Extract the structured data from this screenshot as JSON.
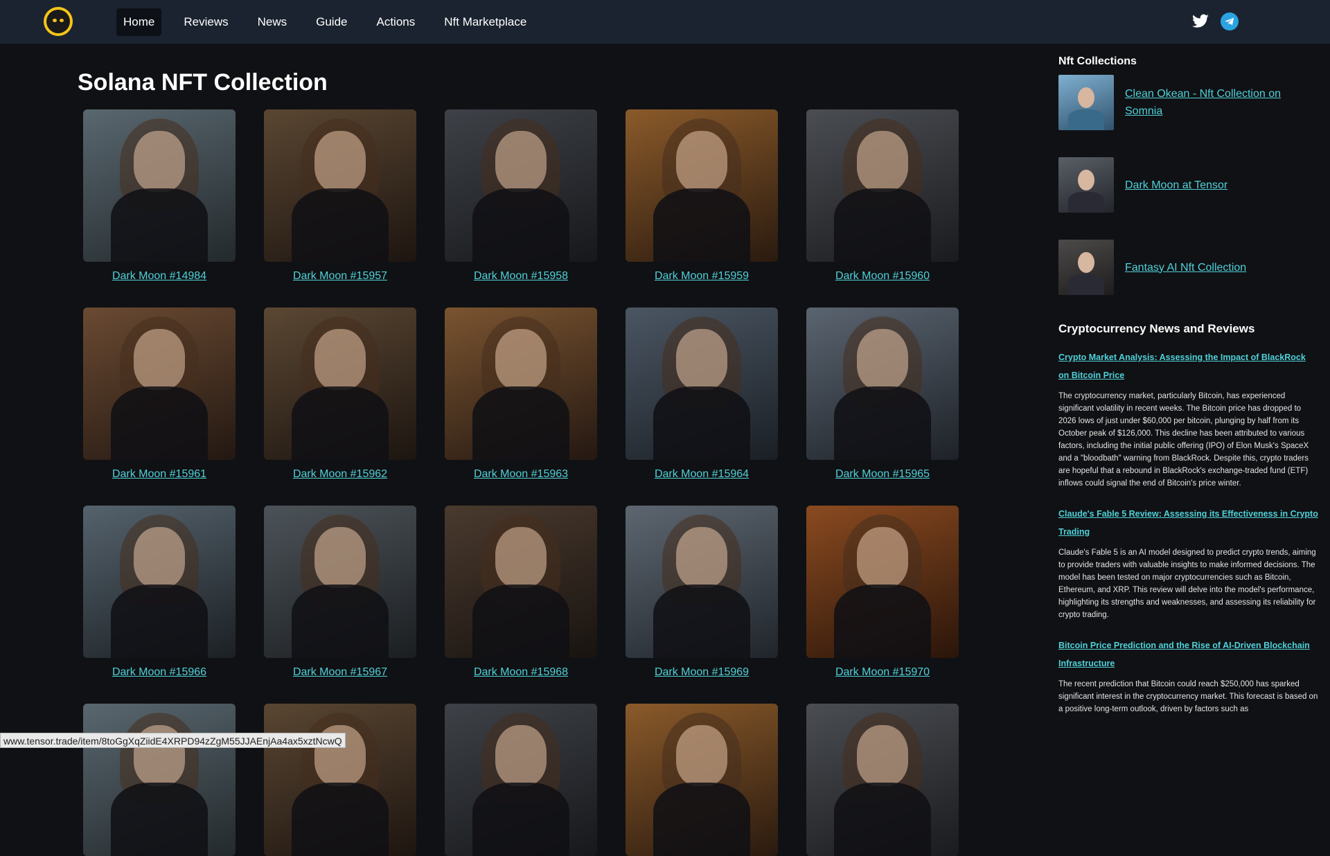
{
  "nav": {
    "items": [
      {
        "label": "Home",
        "active": true
      },
      {
        "label": "Reviews"
      },
      {
        "label": "News"
      },
      {
        "label": "Guide"
      },
      {
        "label": "Actions"
      },
      {
        "label": "Nft Marketplace"
      }
    ]
  },
  "social": [
    "twitter-icon",
    "telegram-icon"
  ],
  "page_title": "Solana NFT Collection",
  "nfts": [
    "Dark Moon #14984",
    "Dark Moon #15957",
    "Dark Moon #15958",
    "Dark Moon #15959",
    "Dark Moon #15960",
    "Dark Moon #15961",
    "Dark Moon #15962",
    "Dark Moon #15963",
    "Dark Moon #15964",
    "Dark Moon #15965",
    "Dark Moon #15966",
    "Dark Moon #15967",
    "Dark Moon #15968",
    "Dark Moon #15969",
    "Dark Moon #15970"
  ],
  "sidebar": {
    "collections_heading": "Nft Collections",
    "collections": [
      "Clean Okean - Nft Collection on Somnia",
      "Dark Moon at Tensor",
      "Fantasy AI Nft Collection"
    ],
    "news_heading": "Cryptocurrency News and Reviews",
    "articles": [
      {
        "title": "Crypto Market Analysis: Assessing the Impact of BlackRock on Bitcoin Price",
        "text": "The cryptocurrency market, particularly Bitcoin, has experienced significant volatility in recent weeks. The Bitcoin price has dropped to 2026 lows of just under $60,000 per bitcoin, plunging by half from its October peak of $126,000. This decline has been attributed to various factors, including the initial public offering (IPO) of Elon Musk's SpaceX and a \"bloodbath\" warning from BlackRock. Despite this, crypto traders are hopeful that a rebound in BlackRock's exchange-traded fund (ETF) inflows could signal the end of Bitcoin's price winter."
      },
      {
        "title": "Claude's Fable 5 Review: Assessing its Effectiveness in Crypto Trading",
        "text": "Claude's Fable 5 is an AI model designed to predict crypto trends, aiming to provide traders with valuable insights to make informed decisions. The model has been tested on major cryptocurrencies such as Bitcoin, Ethereum, and XRP. This review will delve into the model's performance, highlighting its strengths and weaknesses, and assessing its reliability for crypto trading."
      },
      {
        "title": "Bitcoin Price Prediction and the Rise of AI-Driven Blockchain Infrastructure",
        "text": "The recent prediction that Bitcoin could reach $250,000 has sparked significant interest in the cryptocurrency market. This forecast is based on a positive long-term outlook, driven by factors such as"
      }
    ]
  },
  "status_url": "www.tensor.trade/item/8toGgXqZiidE4XRPD94zZgM55JJAEnjAa4ax5xztNcwQ",
  "colors": {
    "accent": "#4fd1d9",
    "topbar": "#1b2330",
    "background": "#101114"
  }
}
